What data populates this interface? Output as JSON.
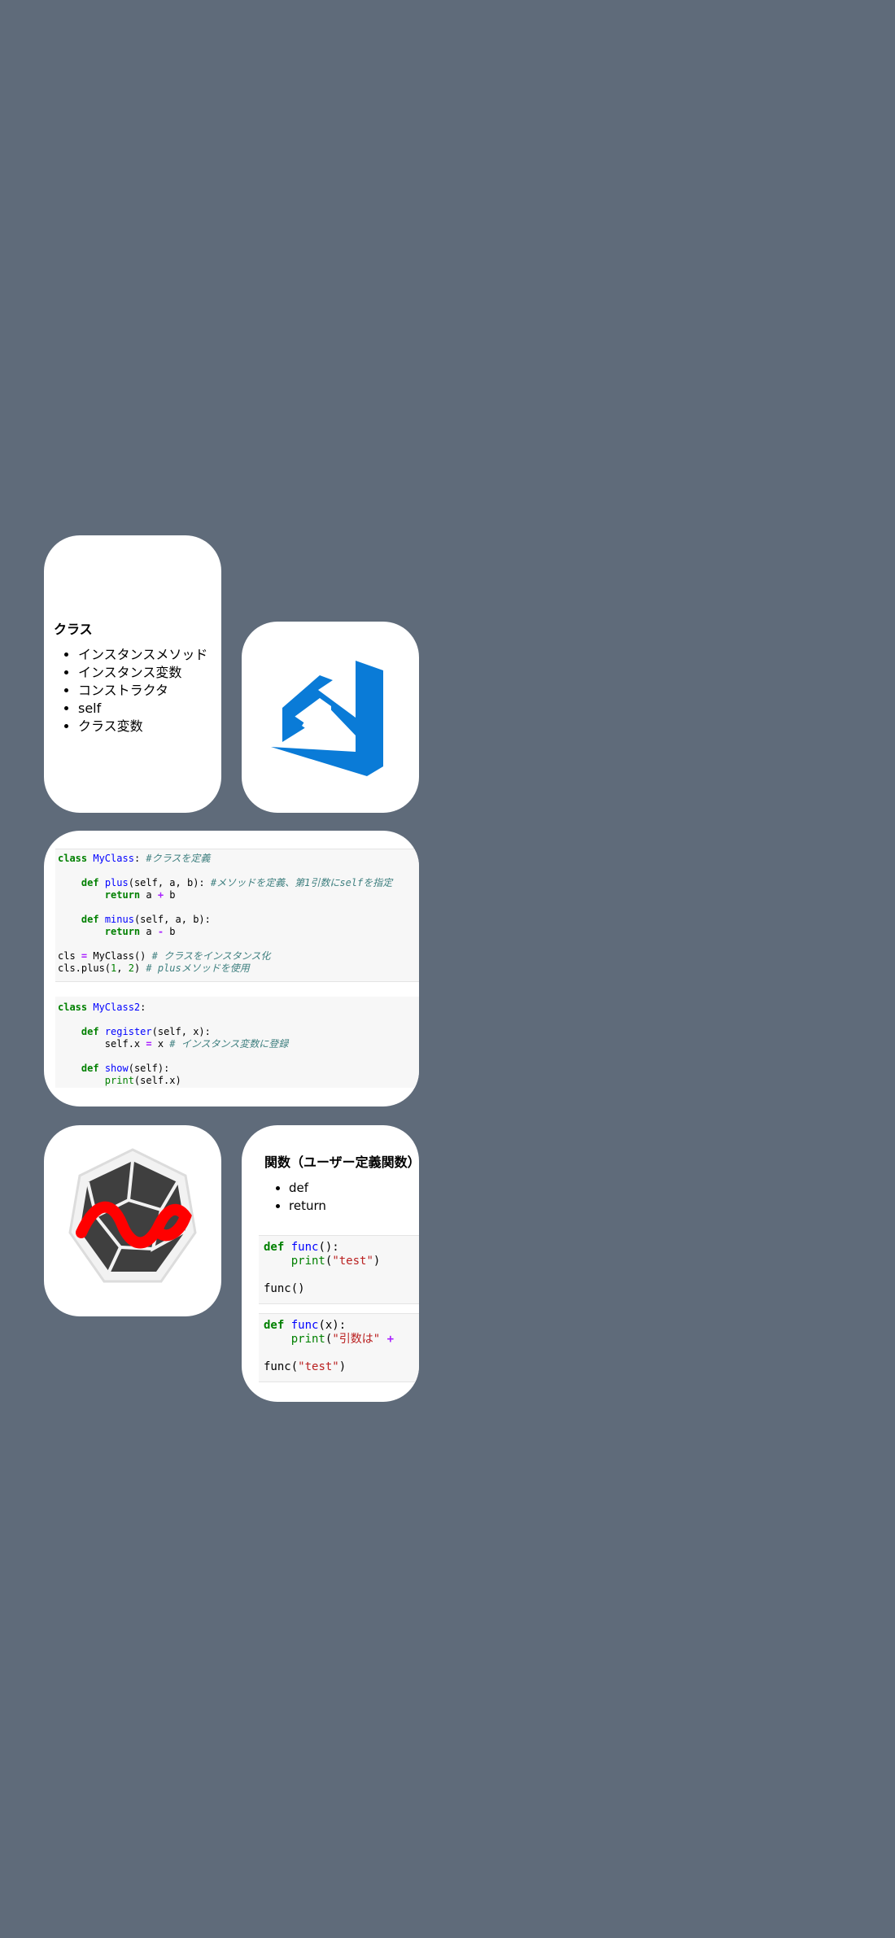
{
  "class_card": {
    "heading": "クラス",
    "items": [
      "インスタンスメソッド",
      "インスタンス変数",
      "コンストラクタ",
      "self",
      "クラス変数"
    ]
  },
  "code_card": {
    "block1": [
      [
        [
          "kw",
          "class"
        ],
        [
          "t",
          " "
        ],
        [
          "fn",
          "MyClass"
        ],
        [
          "t",
          ": "
        ],
        [
          "cm",
          "#クラスを定義"
        ]
      ],
      [],
      [
        [
          "t",
          "    "
        ],
        [
          "kw",
          "def"
        ],
        [
          "t",
          " "
        ],
        [
          "fn",
          "plus"
        ],
        [
          "t",
          "(self, a, b): "
        ],
        [
          "cm",
          "#メソッドを定義、第1引数にselfを指定"
        ]
      ],
      [
        [
          "t",
          "        "
        ],
        [
          "kw",
          "return"
        ],
        [
          "t",
          " a "
        ],
        [
          "op",
          "+"
        ],
        [
          "t",
          " b"
        ]
      ],
      [],
      [
        [
          "t",
          "    "
        ],
        [
          "kw",
          "def"
        ],
        [
          "t",
          " "
        ],
        [
          "fn",
          "minus"
        ],
        [
          "t",
          "(self, a, b):"
        ]
      ],
      [
        [
          "t",
          "        "
        ],
        [
          "kw",
          "return"
        ],
        [
          "t",
          " a "
        ],
        [
          "op",
          "-"
        ],
        [
          "t",
          " b"
        ]
      ],
      [],
      [
        [
          "t",
          "cls "
        ],
        [
          "op",
          "="
        ],
        [
          "t",
          " MyClass() "
        ],
        [
          "cm",
          "# クラスをインスタンス化"
        ]
      ],
      [
        [
          "t",
          "cls.plus("
        ],
        [
          "num",
          "1"
        ],
        [
          "t",
          ", "
        ],
        [
          "num",
          "2"
        ],
        [
          "t",
          ") "
        ],
        [
          "cm",
          "# plusメソッドを使用"
        ]
      ]
    ],
    "block2": [
      [
        [
          "kw",
          "class"
        ],
        [
          "t",
          " "
        ],
        [
          "fn",
          "MyClass2"
        ],
        [
          "t",
          ":"
        ]
      ],
      [],
      [
        [
          "t",
          "    "
        ],
        [
          "kw",
          "def"
        ],
        [
          "t",
          " "
        ],
        [
          "fn",
          "register"
        ],
        [
          "t",
          "(self, x):"
        ]
      ],
      [
        [
          "t",
          "        self.x "
        ],
        [
          "op",
          "="
        ],
        [
          "t",
          " x "
        ],
        [
          "cm",
          "# インスタンス変数に登録"
        ]
      ],
      [],
      [
        [
          "t",
          "    "
        ],
        [
          "kw",
          "def"
        ],
        [
          "t",
          " "
        ],
        [
          "fn",
          "show"
        ],
        [
          "t",
          "(self):"
        ]
      ],
      [
        [
          "t",
          "        "
        ],
        [
          "bi",
          "print"
        ],
        [
          "t",
          "(self.x)"
        ]
      ]
    ]
  },
  "func_card": {
    "heading": "関数（ユーザー定義関数）",
    "items": [
      "def",
      "return"
    ],
    "block1": [
      [
        [
          "kw",
          "def"
        ],
        [
          "t",
          " "
        ],
        [
          "fn",
          "func"
        ],
        [
          "t",
          "():"
        ]
      ],
      [
        [
          "t",
          "    "
        ],
        [
          "bi",
          "print"
        ],
        [
          "t",
          "("
        ],
        [
          "str",
          "\"test\""
        ],
        [
          "t",
          ")"
        ]
      ],
      [],
      [
        [
          "t",
          "func()"
        ]
      ]
    ],
    "block2": [
      [
        [
          "kw",
          "def"
        ],
        [
          "t",
          " "
        ],
        [
          "fn",
          "func"
        ],
        [
          "t",
          "(x):"
        ]
      ],
      [
        [
          "t",
          "    "
        ],
        [
          "bi",
          "print"
        ],
        [
          "t",
          "("
        ],
        [
          "str",
          "\"引数は\""
        ],
        [
          "t",
          " "
        ],
        [
          "op",
          "+"
        ]
      ],
      [],
      [
        [
          "t",
          "func("
        ],
        [
          "str",
          "\"test\""
        ],
        [
          "t",
          ")"
        ]
      ]
    ]
  },
  "icons": {
    "vscode": "vscode-logo-icon",
    "wavy": "red-wave-hexagon-logo-icon"
  },
  "colors": {
    "background": "#5f6b7a",
    "vscode_blue": "#0a7bd7",
    "logo_red": "#ff0000",
    "logo_dark": "#3f3f3f"
  }
}
